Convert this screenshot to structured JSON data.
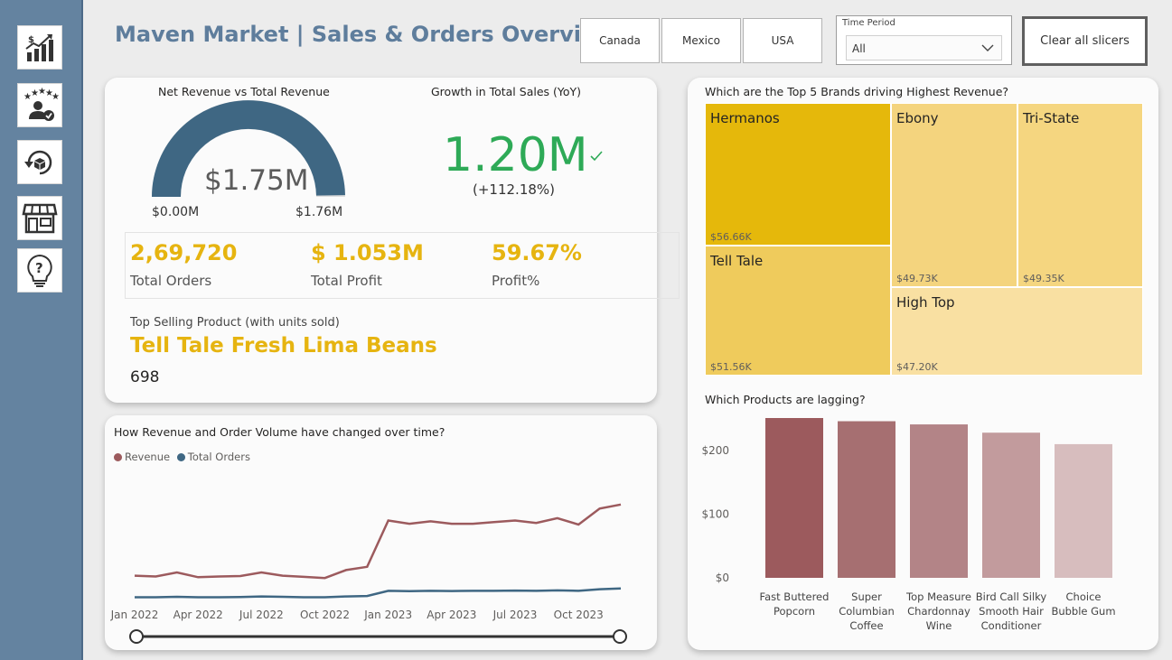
{
  "header": {
    "title": "Maven Market | Sales & Orders Overview"
  },
  "nav": {
    "items": [
      "sales-chart-icon",
      "customer-rating-icon",
      "refresh-returns-icon",
      "store-icon",
      "help-bulb-icon"
    ]
  },
  "slicers": {
    "countries": [
      "Canada",
      "Mexico",
      "USA"
    ],
    "time_period": {
      "label": "Time Period",
      "value": "All"
    },
    "clear_label": "Clear all slicers"
  },
  "summary": {
    "gauge": {
      "title": "Net Revenue vs Total Revenue",
      "value_label": "$1.75M",
      "min_label": "$0.00M",
      "max_label": "$1.76M",
      "value": 1.75,
      "max": 1.76
    },
    "growth": {
      "title": "Growth in Total Sales (YoY)",
      "value": "1.20M",
      "pct": "(+112.18%)",
      "check_icon": "checkmark-icon",
      "color": "#2eaa57"
    },
    "kpis": [
      {
        "value": "2,69,720",
        "label": "Total Orders"
      },
      {
        "value": "$ 1.053M",
        "label": "Total Profit"
      },
      {
        "value": "59.67%",
        "label": "Profit%"
      }
    ],
    "top_product": {
      "title": "Top Selling Product (with units sold)",
      "name": "Tell Tale Fresh Lima Beans",
      "units": "698"
    },
    "accent_color": "#e6b410",
    "gauge_color": "#3f6783"
  },
  "line_chart": {
    "title": "How Revenue and Order Volume have changed over time?",
    "legend": [
      {
        "name": "Revenue",
        "color": "#9c5a5d"
      },
      {
        "name": "Total Orders",
        "color": "#3f6783"
      }
    ],
    "x_ticks": [
      "Jan 2022",
      "Apr 2022",
      "Jul 2022",
      "Oct 2022",
      "Jan 2023",
      "Apr 2023",
      "Jul 2023",
      "Oct 2023"
    ],
    "chart_data": {
      "type": "line",
      "x": [
        "Jan 2022",
        "Feb 2022",
        "Mar 2022",
        "Apr 2022",
        "May 2022",
        "Jun 2022",
        "Jul 2022",
        "Aug 2022",
        "Sep 2022",
        "Oct 2022",
        "Nov 2022",
        "Dec 2022",
        "Jan 2023",
        "Feb 2023",
        "Mar 2023",
        "Apr 2023",
        "May 2023",
        "Jun 2023",
        "Jul 2023",
        "Aug 2023",
        "Sep 2023",
        "Oct 2023",
        "Nov 2023",
        "Dec 2023"
      ],
      "series": [
        {
          "name": "Revenue",
          "values": [
            31,
            30,
            35,
            29,
            30,
            30.5,
            35,
            31,
            29.5,
            28,
            38,
            42,
            100,
            96,
            99,
            96,
            96,
            98,
            100,
            97,
            103,
            95,
            115,
            120
          ]
        },
        {
          "name": "Total Orders",
          "values": [
            4,
            4,
            4.5,
            4,
            4,
            4.3,
            5,
            4.5,
            4,
            4,
            5,
            5.5,
            12,
            11.5,
            12,
            11.8,
            12,
            12,
            12.3,
            12,
            12.5,
            12,
            14,
            15
          ]
        }
      ]
    }
  },
  "treemap": {
    "title": "Which are the Top 5 Brands driving Highest Revenue?",
    "chart_data": {
      "type": "treemap",
      "items": [
        {
          "name": "Hermanos",
          "value": 56.66,
          "label": "$56.66K",
          "color": "#e5b80b"
        },
        {
          "name": "Tell Tale",
          "value": 51.56,
          "label": "$51.56K",
          "color": "#efcb5c"
        },
        {
          "name": "Ebony",
          "value": 49.73,
          "label": "$49.73K",
          "color": "#f4d47e"
        },
        {
          "name": "Tri-State",
          "value": 49.35,
          "label": "$49.35K",
          "color": "#f5d680"
        },
        {
          "name": "High Top",
          "value": 47.2,
          "label": "$47.20K",
          "color": "#f9e0a2"
        }
      ]
    }
  },
  "bar_chart": {
    "title": "Which Products are lagging?",
    "y_ticks": [
      "$200",
      "$100",
      "$0"
    ],
    "chart_data": {
      "type": "bar",
      "categories": [
        [
          "Fast Buttered",
          "Popcorn"
        ],
        [
          "Super",
          "Columbian",
          "Coffee"
        ],
        [
          "Top Measure",
          "Chardonnay",
          "Wine"
        ],
        [
          "Bird Call Silky",
          "Smooth Hair",
          "Conditioner"
        ],
        [
          "Choice",
          "Bubble Gum"
        ]
      ],
      "values": [
        251,
        246,
        241,
        228,
        210
      ],
      "colors": [
        "#9c5a5d",
        "#a66f71",
        "#b38487",
        "#c29b9d",
        "#d7bdbe"
      ],
      "ylim": [
        0,
        251
      ]
    }
  }
}
